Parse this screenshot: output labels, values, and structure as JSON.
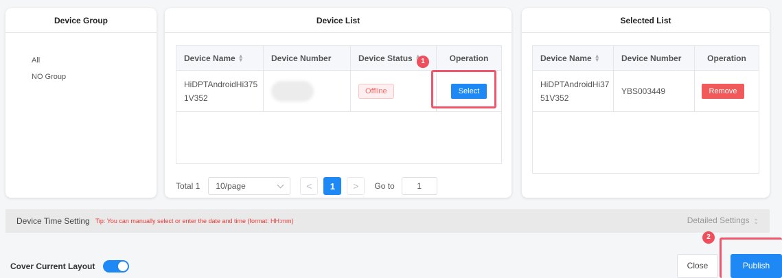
{
  "device_group": {
    "title": "Device Group",
    "items": [
      "All",
      "NO Group"
    ]
  },
  "device_list": {
    "title": "Device List",
    "columns": [
      "Device Name",
      "Device Number",
      "Device Status",
      "Operation"
    ],
    "rows": [
      {
        "name_line1": "HiDPTAndroidHi375",
        "name_line2": "1V352",
        "number": "",
        "status": "Offline",
        "action": "Select"
      }
    ],
    "pagination": {
      "total_label": "Total 1",
      "page_size": "10/page",
      "prev": "<",
      "current_page": "1",
      "next": ">",
      "goto_label": "Go to",
      "goto_value": "1"
    }
  },
  "selected_list": {
    "title": "Selected List",
    "columns": [
      "Device Name",
      "Device Number",
      "Operation"
    ],
    "rows": [
      {
        "name_line1": "HiDPTAndroidHi37",
        "name_line2": "51V352",
        "number": "YBS003449",
        "action": "Remove"
      }
    ]
  },
  "time_setting": {
    "label": "Device Time Setting",
    "tip": "Tip: You can manually select or enter the date and time (format: HH:mm)",
    "detailed_label": "Detailed Settings"
  },
  "footer": {
    "cover_label": "Cover Current Layout",
    "cover_enabled": true,
    "close_label": "Close",
    "publish_label": "Publish"
  },
  "annotations": {
    "step1": "1",
    "step2": "2"
  },
  "colors": {
    "primary": "#1e88f5",
    "danger": "#f05a5a",
    "highlight": "#f0566b"
  }
}
